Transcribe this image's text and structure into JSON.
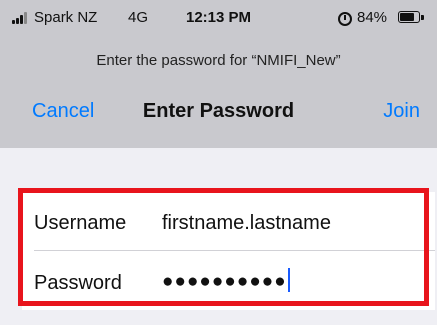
{
  "status_bar": {
    "carrier": "Spark NZ",
    "network": "4G",
    "time": "12:13 PM",
    "battery_percent_text": "84%",
    "battery_level": 0.84,
    "icons": [
      "signal-bars-icon",
      "alarm-icon",
      "battery-icon"
    ]
  },
  "prompt": "Enter the password for “NMIFI_New”",
  "nav": {
    "cancel": "Cancel",
    "title": "Enter Password",
    "join": "Join"
  },
  "form": {
    "username_label": "Username",
    "username_value": "firstname.lastname",
    "password_label": "Password",
    "password_value": "●●●●●●●●●●"
  },
  "colors": {
    "accent": "#007aff",
    "highlight_frame": "#e8141c",
    "header_background": "#c9c9ce"
  }
}
